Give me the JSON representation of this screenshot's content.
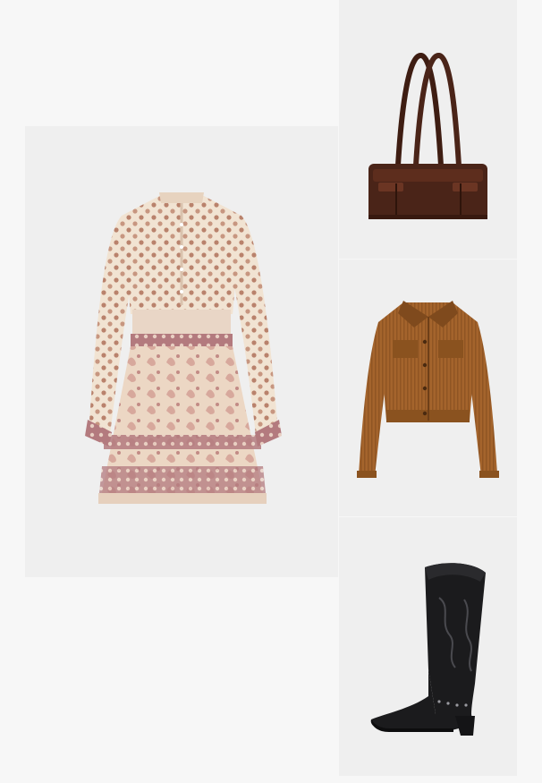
{
  "outfit": {
    "items": [
      {
        "id": "dress",
        "icon": "dress-icon",
        "colors": {
          "base": "#efe1cf",
          "print": "#b9826c",
          "hem": "#a8707a"
        }
      },
      {
        "id": "bag",
        "icon": "shoulder-bag-icon",
        "colors": {
          "base": "#4a2418",
          "highlight": "#6b3523"
        }
      },
      {
        "id": "jacket",
        "icon": "corduroy-jacket-icon",
        "colors": {
          "base": "#a4642c",
          "shade": "#7f4a1d"
        }
      },
      {
        "id": "boot",
        "icon": "cowboy-boot-icon",
        "colors": {
          "base": "#1b1b1d",
          "stitch": "#3a3a3e"
        }
      }
    ]
  }
}
